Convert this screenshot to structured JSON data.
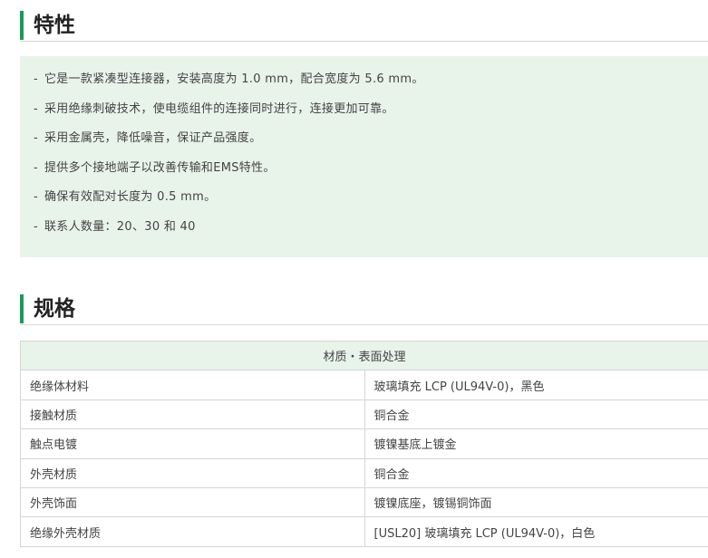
{
  "features": {
    "title": "特性",
    "items": [
      "它是一款紧凑型连接器，安装高度为 1.0 mm，配合宽度为 5.6 mm。",
      "采用绝缘刺破技术，使电缆组件的连接同时进行，连接更加可靠。",
      "采用金属壳，降低噪音，保证产品强度。",
      "提供多个接地端子以改善传输和EMS特性。",
      "确保有效配对长度为 0.5 mm。",
      "联系人数量：20、30 和 40"
    ],
    "bullet": "-"
  },
  "spec": {
    "title": "规格",
    "table_header": "材质・表面处理",
    "rows": [
      {
        "label": "绝缘体材料",
        "value": "玻璃填充 LCP (UL94V-0)，黑色"
      },
      {
        "label": "接触材质",
        "value": "铜合金"
      },
      {
        "label": "触点电镀",
        "value": "镀镍基底上镀金"
      },
      {
        "label": "外壳材质",
        "value": "铜合金"
      },
      {
        "label": "外壳饰面",
        "value": "镀镍底座，镀锡铜饰面"
      },
      {
        "label": "绝缘外壳材质",
        "value": "[USL20] 玻璃填充 LCP (UL94V-0)，白色"
      }
    ]
  },
  "colors": {
    "accent": "#1a9a5a",
    "panel_bg": "#e8f3ea"
  }
}
